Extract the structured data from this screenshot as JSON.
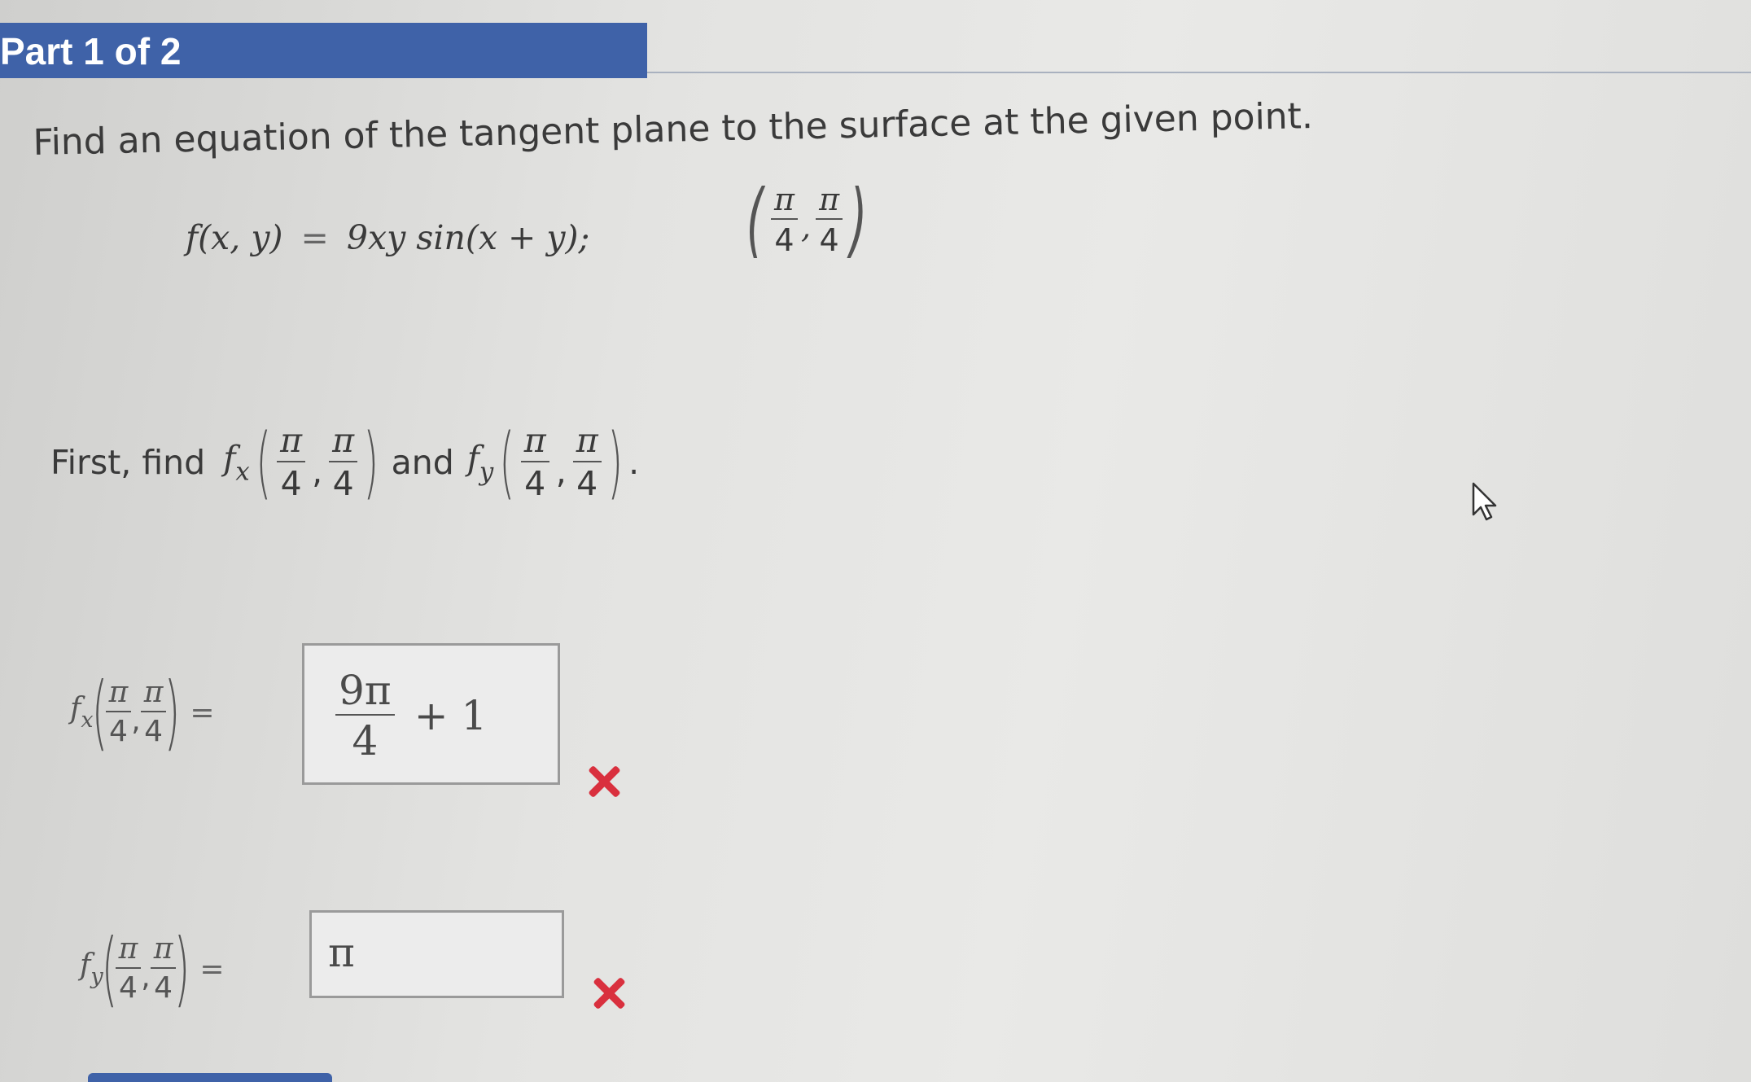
{
  "header": {
    "title": "Part 1 of 2"
  },
  "question": {
    "prompt": "Find an equation of the tangent plane to the surface at the given point.",
    "function_lhs": "f(x, y)",
    "equals": "=",
    "function_rhs": "9xy sin(x + y);",
    "point": {
      "x_num": "π",
      "x_den": "4",
      "sep": ",",
      "y_num": "π",
      "y_den": "4"
    }
  },
  "instruction": {
    "first_find": "First, find",
    "fx": "f",
    "fx_sub": "x",
    "and": "and",
    "fy": "f",
    "fy_sub": "y",
    "arg": {
      "num": "π",
      "den": "4",
      "sep": ","
    },
    "period": "."
  },
  "answers": {
    "fx": {
      "label": "f",
      "label_sub": "x",
      "equals": "=",
      "value_num": "9π",
      "value_den": "4",
      "value_tail": "+ 1",
      "status": "incorrect"
    },
    "fy": {
      "label": "f",
      "label_sub": "y",
      "equals": "=",
      "value": "π",
      "status": "incorrect"
    }
  },
  "colors": {
    "header_bg": "#3f62a8",
    "incorrect_mark": "#d9303e"
  },
  "icons": [
    "close-icon",
    "close-icon",
    "mouse-pointer-icon"
  ]
}
